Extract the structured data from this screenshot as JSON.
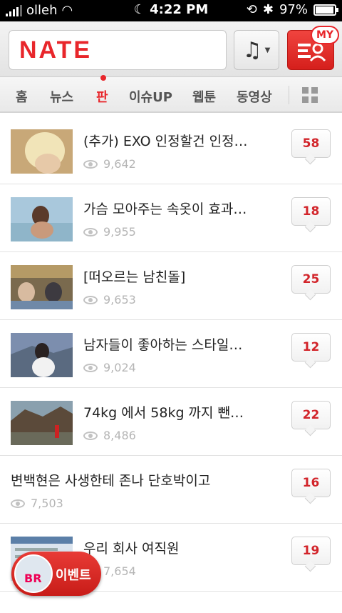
{
  "status_bar": {
    "carrier": "olleh",
    "time": "4:22 PM",
    "battery": "97%",
    "battery_level": 0.97
  },
  "header": {
    "logo": "NATE",
    "my_badge": "MY"
  },
  "tabs": [
    "홈",
    "뉴스",
    "판",
    "이슈UP",
    "웹툰",
    "동영상"
  ],
  "active_tab": "판",
  "posts": [
    {
      "title": "(추가) EXO 인정할건 인정…",
      "views": "9,642",
      "comments": "58",
      "has_thumb": true
    },
    {
      "title": "가슴 모아주는 속옷이 효과…",
      "views": "9,955",
      "comments": "18",
      "has_thumb": true
    },
    {
      "title": "[떠오르는 남친돌]",
      "views": "9,653",
      "comments": "25",
      "has_thumb": true
    },
    {
      "title": "남자들이 좋아하는 스타일…",
      "views": "9,024",
      "comments": "12",
      "has_thumb": true
    },
    {
      "title": "74kg 에서 58kg 까지 뺀…",
      "views": "8,486",
      "comments": "22",
      "has_thumb": true
    },
    {
      "title": "변백현은 사생한테 존나 단호박이고",
      "views": "7,503",
      "comments": "16",
      "has_thumb": false
    },
    {
      "title": "우리 회사 여직원",
      "views": "7,654",
      "comments": "19",
      "has_thumb": true
    }
  ],
  "event_button": {
    "label": "이벤트",
    "icon_text": "BR"
  },
  "colors": {
    "brand_red": "#e8262b",
    "comment_red": "#d2242a"
  }
}
